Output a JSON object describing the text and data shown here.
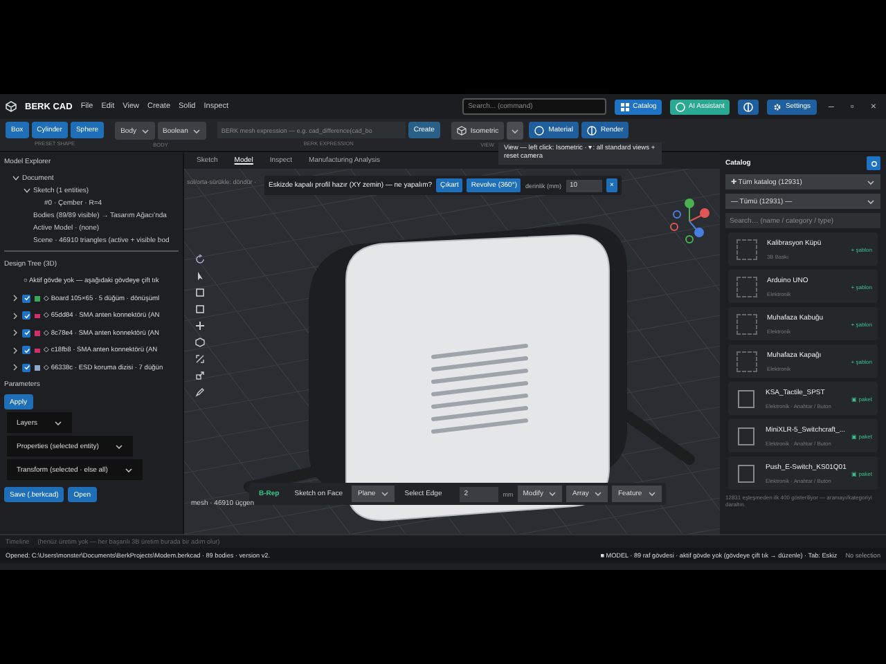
{
  "app": {
    "title": "BERK CAD"
  },
  "menu": [
    "File",
    "Edit",
    "View",
    "Create",
    "Solid",
    "Inspect"
  ],
  "command_search": {
    "placeholder": "Search... (command)"
  },
  "header_buttons": [
    {
      "kind": "catalog",
      "label": "Catalog"
    },
    {
      "kind": "assistant",
      "label": "AI Assistant"
    },
    {
      "kind": "theme"
    },
    {
      "kind": "settings",
      "label": "Settings"
    }
  ],
  "window_controls": [
    "–",
    "▫",
    "×"
  ],
  "toolbar": {
    "preset_shape": {
      "label": "PRESET SHAPE",
      "buttons": [
        "Box",
        "Cylinder",
        "Sphere"
      ]
    },
    "body": {
      "label": "BODY",
      "dropdowns": [
        "Body",
        "Boolean"
      ]
    },
    "expression": {
      "label": "BERK EXPRESSION",
      "placeholder": "BERK mesh expression — e.g. cad_difference(cad_bo",
      "button": "Create"
    },
    "view": {
      "label": "VIEW",
      "value": "Isometric"
    },
    "toggles": [
      "Material",
      "Render"
    ]
  },
  "tooltip": {
    "text": "View — left click: Isometric · ▾: all standard views + reset camera"
  },
  "model_explorer": {
    "title": "Model Explorer",
    "tree": [
      {
        "label": "Document",
        "expanded": true,
        "children": [
          {
            "label": "Sketch (1 entities)",
            "expanded": true,
            "children": [
              {
                "label": "#0 · Çember · R=4"
              }
            ]
          },
          {
            "label": "Bodies (89/89 visible) → Tasarım Ağacı'nda"
          },
          {
            "label": "Active Model · (none)"
          },
          {
            "label": "Scene · 46910 triangles (active + visible bod"
          }
        ]
      }
    ]
  },
  "design_tree": {
    "title": "Design Tree (3D)",
    "note": "○ Aktif gövde yok — aşağıdaki gövdeye çift tık",
    "rows": [
      {
        "label": "◇ Board 105×65 · 5 düğüm · dönüşüml",
        "checked": true,
        "color": "#3aa55d"
      },
      {
        "label": "◇ 65dd84 · SMA anten konnektörü (AN",
        "checked": true,
        "color": "#d0306a"
      },
      {
        "label": "◇ 8c78e4 · SMA anten konnektörü (AN",
        "checked": true,
        "color": "#d0306a"
      },
      {
        "label": "◇ c18fb8 · SMA anten konnektörü (AN",
        "checked": true,
        "color": "#d0306a"
      },
      {
        "label": "◇ 66338c · ESD koruma dizisi · 7 düğün",
        "checked": true,
        "color": "#8fa8c8"
      }
    ]
  },
  "parameters": {
    "title": "Parameters",
    "apply": "Apply",
    "sections": [
      "Layers",
      "Properties (selected entity)",
      "Transform (selected · else all)"
    ]
  },
  "file_buttons": [
    "Save (.berkcad)",
    "Open"
  ],
  "viewport": {
    "tabs": [
      {
        "label": "Sketch",
        "selected": false
      },
      {
        "label": "Model",
        "selected": true
      },
      {
        "label": "Inspect",
        "selected": false
      },
      {
        "label": "Manufacturing Analysis",
        "selected": false
      }
    ],
    "hint": "sol/orta-sürükle: döndür ·",
    "prompt": {
      "text": "Eskizde kapalı profil hazır (XY zemin) — ne yapalım?",
      "buttons": [
        "Çıkart",
        "Revolve (360°)"
      ],
      "depth_label": "derinlik (mm)",
      "depth_value": "10",
      "close": "×"
    },
    "mesh_info": "mesh · 46910 üçgen",
    "bottom_tools": [
      {
        "kind": "mode",
        "label": "B-Rep"
      },
      {
        "kind": "button",
        "label": "Sketch on Face"
      },
      {
        "kind": "dropdown",
        "label": "Plane"
      },
      {
        "kind": "button",
        "label": "Select Edge"
      },
      {
        "kind": "number",
        "value": "2",
        "unit": "mm"
      },
      {
        "kind": "dropdown",
        "label": "Modify"
      },
      {
        "kind": "dropdown",
        "label": "Array"
      },
      {
        "kind": "dropdown",
        "label": "Feature"
      }
    ]
  },
  "catalog": {
    "title": "Catalog",
    "source": "✚ Tüm katalog (12931)",
    "category": "— Tümü (12931) —",
    "search_placeholder": "Search… (name / category / type)",
    "items": [
      {
        "name": "Kalibrasyon Küpü",
        "category": "3B Baskı",
        "kind": "template",
        "badge": "+ şablon"
      },
      {
        "name": "Arduino UNO",
        "category": "Elektronik",
        "kind": "template",
        "badge": "+ şablon"
      },
      {
        "name": "Muhafaza Kabuğu",
        "category": "Elektronik",
        "kind": "template",
        "badge": "+ şablon"
      },
      {
        "name": "Muhafaza Kapağı",
        "category": "Elektronik",
        "kind": "template",
        "badge": "+ şablon"
      },
      {
        "name": "KSA_Tactile_SPST",
        "category": "Elektronik · Anahtar / Buton",
        "kind": "package",
        "badge": "▣ paket"
      },
      {
        "name": "MiniXLR-5_Switchcraft_...",
        "category": "Elektronik · Anahtar / Buton",
        "kind": "package",
        "badge": "▣ paket"
      },
      {
        "name": "Push_E-Switch_KS01Q01",
        "category": "Elektronik · Anahtar / Buton",
        "kind": "package",
        "badge": "▣ paket"
      }
    ],
    "footer": "12831 eşleşmeden ilk 400 gösteriliyor — aramayı/kategoriyi daraltın."
  },
  "timeline": {
    "label": "Timeline",
    "text": "(henüz üretim yok — her başarılı 3B üretim burada bir adım olur)"
  },
  "status_bar": {
    "left": "Opened: C:\\Users\\monster\\Documents\\BerkProjects\\Modem.berkcad · 89 bodies · version v2.",
    "mode": "■ MODEL · 89 raf gövdesi · aktif gövde yok (gövdeye çift tık → düzenle) · Tab: Eskiz",
    "selection": "No selection"
  }
}
